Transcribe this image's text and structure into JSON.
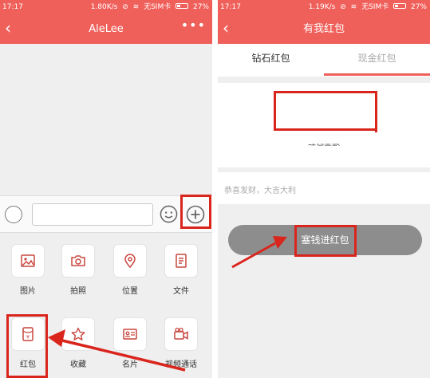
{
  "accent_color": "#f0605b",
  "highlight_color": "#d9251c",
  "left_screen": {
    "status": {
      "time": "17:17",
      "speed": "1.80K/s",
      "carrier": "无SIM卡",
      "battery": "27%"
    },
    "header": {
      "back_icon": "chevron-left-icon",
      "title": "AleLee",
      "more_icon": "more-dots-icon"
    },
    "input_bar": {
      "voice_icon": "voice-icon",
      "emoji_icon": "emoji-icon",
      "plus_icon": "plus-circle-icon"
    },
    "tools": [
      {
        "label": "图片",
        "icon": "image-icon"
      },
      {
        "label": "拍照",
        "icon": "camera-icon"
      },
      {
        "label": "位置",
        "icon": "location-icon"
      },
      {
        "label": "文件",
        "icon": "file-icon"
      },
      {
        "label": "红包",
        "icon": "red-envelope-icon"
      },
      {
        "label": "收藏",
        "icon": "star-icon"
      },
      {
        "label": "名片",
        "icon": "card-icon"
      },
      {
        "label": "视频通话",
        "icon": "video-call-icon"
      }
    ]
  },
  "right_screen": {
    "status": {
      "time": "17:17",
      "speed": "1.19K/s",
      "carrier": "无SIM卡",
      "battery": "27%"
    },
    "header": {
      "back_icon": "chevron-left-icon",
      "title": "有我红包"
    },
    "tabs": [
      {
        "label": "钻石红包",
        "active": false
      },
      {
        "label": "现金红包",
        "active": true
      }
    ],
    "amount_label": "红包金额",
    "blessing": "恭喜发财，大吉大利",
    "submit_label": "塞钱进红包"
  }
}
